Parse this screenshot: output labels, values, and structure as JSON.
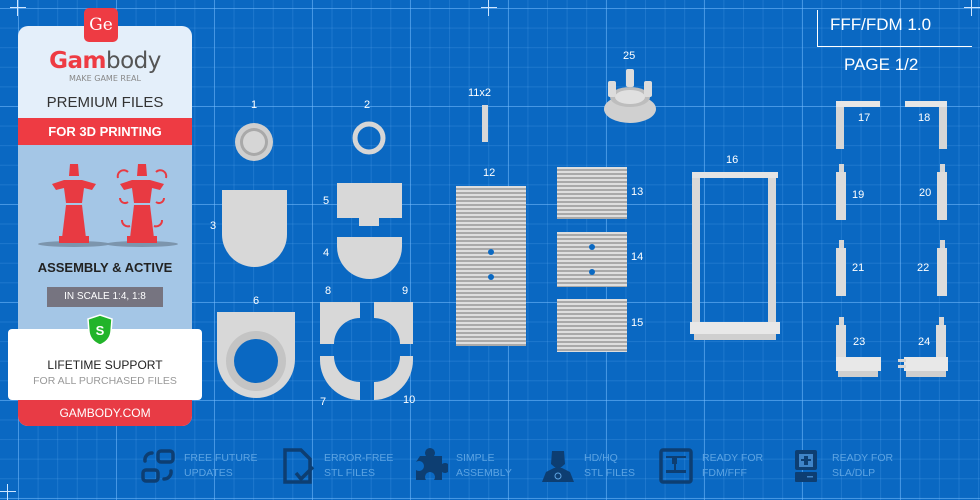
{
  "brand": {
    "logo_mark": "Ge",
    "name_red": "Gam",
    "name_grey": "body",
    "tagline": "MAKE GAME REAL",
    "accent_color": "#ee3b43"
  },
  "promo": {
    "premium": "PREMIUM FILES",
    "printing": "FOR 3D PRINTING",
    "assembly": "ASSEMBLY & ACTIVE",
    "scale": "IN SCALE 1:4, 1:8",
    "shield_letter": "S",
    "lifetime": "LIFETIME SUPPORT",
    "purchased": "FOR ALL PURCHASED FILES",
    "site": "GAMBODY.COM"
  },
  "header": {
    "title": "FFF/FDM 1.0",
    "page": "PAGE 1/2"
  },
  "parts": {
    "p1": "1",
    "p2": "2",
    "p3": "3",
    "p4": "4",
    "p5": "5",
    "p6": "6",
    "p7": "7",
    "p8": "8",
    "p9": "9",
    "p10": "10",
    "p11": "11x2",
    "p12": "12",
    "p13": "13",
    "p14": "14",
    "p15": "15",
    "p16": "16",
    "p17": "17",
    "p18": "18",
    "p19": "19",
    "p20": "20",
    "p21": "21",
    "p22": "22",
    "p23": "23",
    "p24": "24",
    "p25": "25"
  },
  "features": [
    {
      "icon": "update-arrows-icon",
      "line1": "FREE FUTURE",
      "line2": "UPDATES"
    },
    {
      "icon": "file-check-icon",
      "line1": "ERROR-FREE",
      "line2": "STL FILES"
    },
    {
      "icon": "puzzle-icon",
      "line1": "SIMPLE",
      "line2": "ASSEMBLY"
    },
    {
      "icon": "hero-bust-icon",
      "line1": "HD/HQ",
      "line2": "STL FILES"
    },
    {
      "icon": "fdm-printer-icon",
      "line1": "READY FOR",
      "line2": "FDM/FFF"
    },
    {
      "icon": "sla-printer-icon",
      "line1": "READY FOR",
      "line2": "SLA/DLP"
    }
  ]
}
